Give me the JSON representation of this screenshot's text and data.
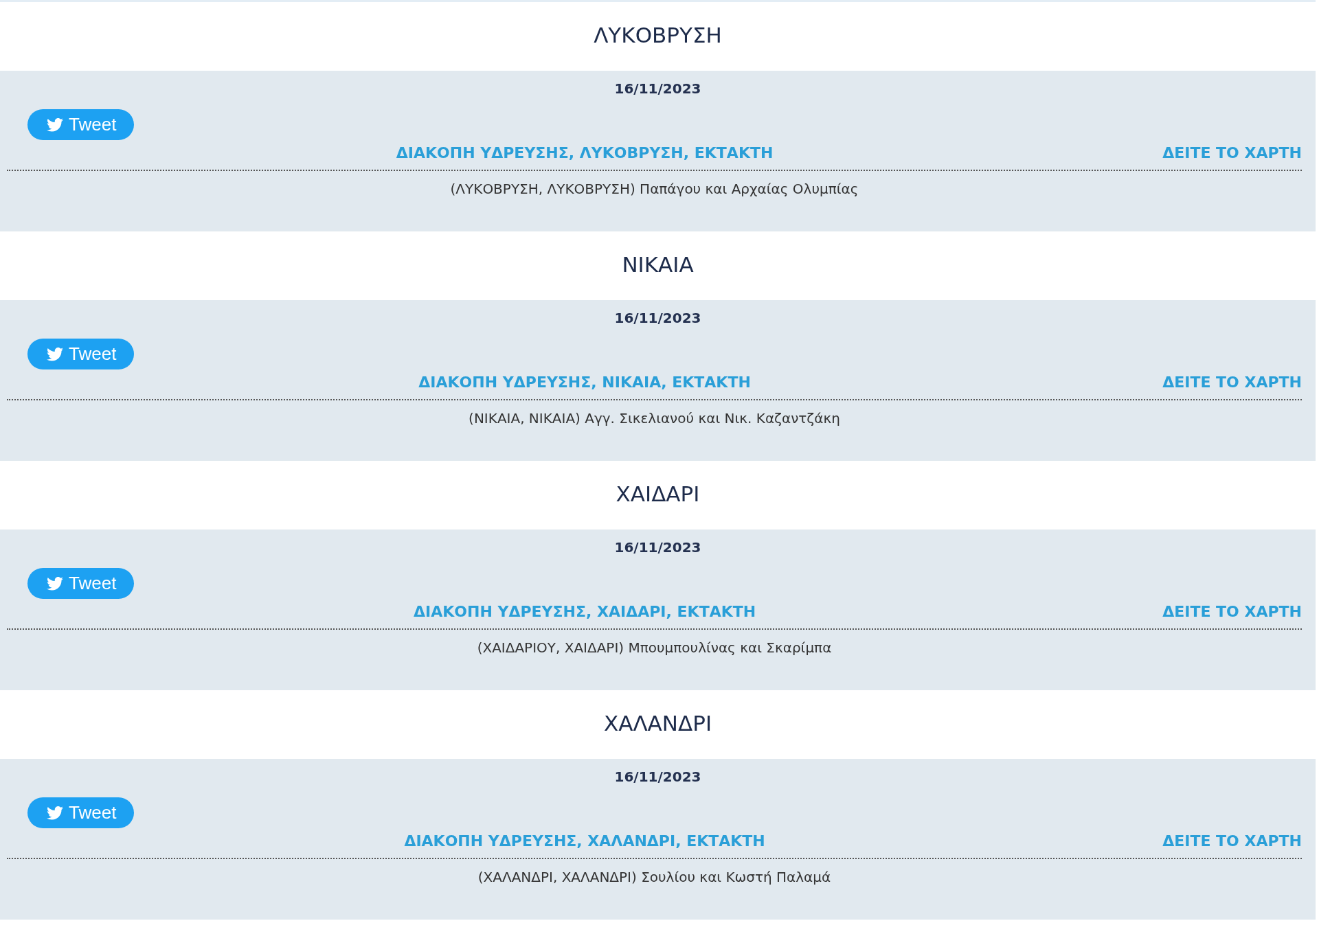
{
  "sections": [
    {
      "heading": "ΛΥΚΟΒΡΥΣΗ",
      "date": "16/11/2023",
      "tweet": "Tweet",
      "title": "ΔΙΑΚΟΠΗ ΥΔΡΕΥΣΗΣ, ΛΥΚΟΒΡΥΣΗ, ΕΚΤΑΚΤΗ",
      "map_link": "ΔΕΙΤΕ ΤΟ ΧΑΡΤΗ",
      "address": "(ΛΥΚΟΒΡΥΣΗ, ΛΥΚΟΒΡΥΣΗ) Παπάγου και Αρχαίας Ολυμπίας"
    },
    {
      "heading": "ΝΙΚΑΙΑ",
      "date": "16/11/2023",
      "tweet": "Tweet",
      "title": "ΔΙΑΚΟΠΗ ΥΔΡΕΥΣΗΣ, ΝΙΚΑΙΑ, ΕΚΤΑΚΤΗ",
      "map_link": "ΔΕΙΤΕ ΤΟ ΧΑΡΤΗ",
      "address": "(ΝΙΚΑΙΑ, ΝΙΚΑΙΑ) Αγγ. Σικελιανού και Νικ. Καζαντζάκη"
    },
    {
      "heading": "ΧΑΙΔΑΡΙ",
      "date": "16/11/2023",
      "tweet": "Tweet",
      "title": "ΔΙΑΚΟΠΗ ΥΔΡΕΥΣΗΣ, ΧΑΙΔΑΡΙ, ΕΚΤΑΚΤΗ",
      "map_link": "ΔΕΙΤΕ ΤΟ ΧΑΡΤΗ",
      "address": "(ΧΑΙΔΑΡΙΟΥ, ΧΑΙΔΑΡΙ) Μπουμπουλίνας και Σκαρίμπα"
    },
    {
      "heading": "ΧΑΛΑΝΔΡΙ",
      "date": "16/11/2023",
      "tweet": "Tweet",
      "title": "ΔΙΑΚΟΠΗ ΥΔΡΕΥΣΗΣ, ΧΑΛΑΝΔΡΙ, ΕΚΤΑΚΤΗ",
      "map_link": "ΔΕΙΤΕ ΤΟ ΧΑΡΤΗ",
      "address": "(ΧΑΛΑΝΔΡΙ, ΧΑΛΑΝΔΡΙ) Σουλίου και Κωστή Παλαμά"
    }
  ]
}
